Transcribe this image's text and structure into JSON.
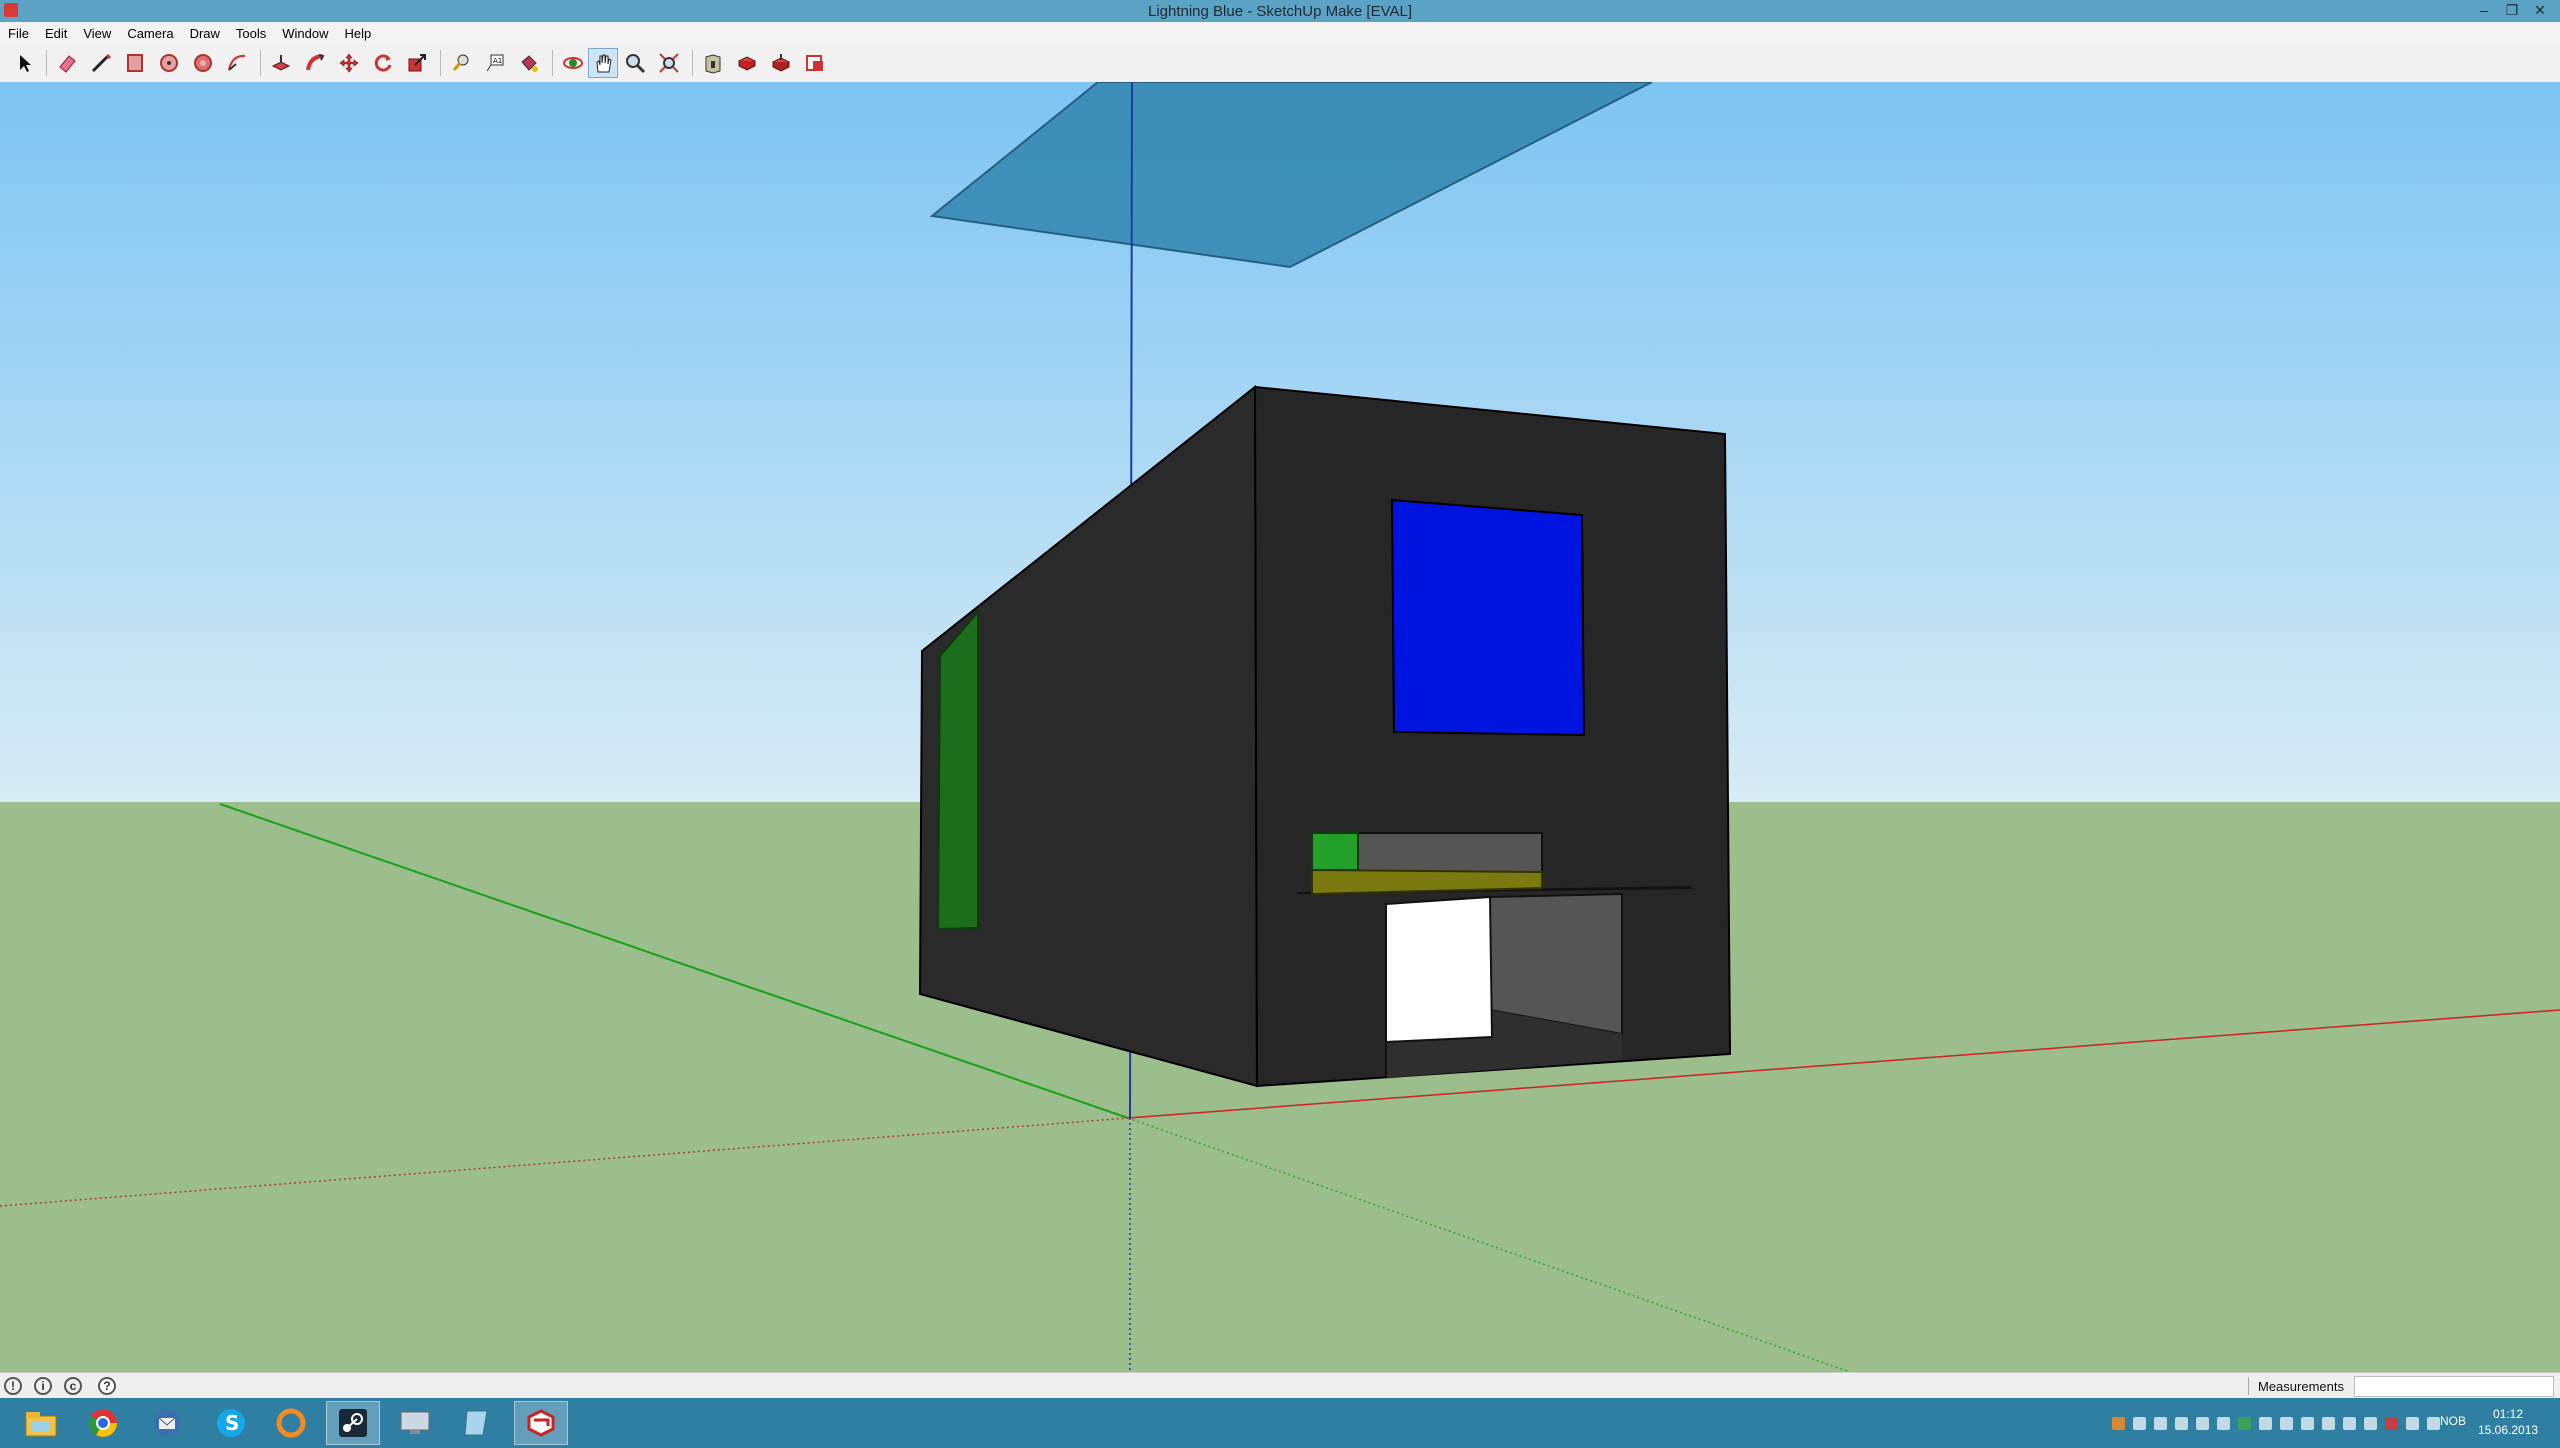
{
  "window": {
    "title": "Lightning Blue - SketchUp Make [EVAL]",
    "controls": [
      "minimize-icon",
      "restore-icon",
      "close-icon"
    ]
  },
  "menu": [
    "File",
    "Edit",
    "View",
    "Camera",
    "Draw",
    "Tools",
    "Window",
    "Help"
  ],
  "toolbar": {
    "tools": [
      "select",
      "eraser",
      "line",
      "rectangle",
      "circle",
      "polygon",
      "arc",
      "push-pull",
      "follow-me",
      "move",
      "rotate",
      "scale",
      "tape-measure",
      "text",
      "paint-bucket",
      "orbit",
      "pan",
      "zoom",
      "zoom-extents",
      "3d-warehouse",
      "get-models",
      "share-model",
      "send-to-layout"
    ],
    "active_tool": "pan"
  },
  "scene": {
    "colors": {
      "sky_top": "#7dc4f3",
      "sky_bottom": "#d8ecf5",
      "ground": "#9cbd8c",
      "walls": "#262626",
      "window_blue": "#0014e0",
      "panel_green": "#1a7a1a",
      "floor_olive": "#7a7a10",
      "door_white": "#ffffff",
      "roof_plane": "#3a8db8"
    }
  },
  "status": {
    "help_icons": [
      "geo-location-icon",
      "credits-icon",
      "copyright-icon",
      "help-icon"
    ],
    "measurements_label": "Measurements",
    "measurements_value": ""
  },
  "taskbar": {
    "apps": [
      "file-explorer",
      "chrome",
      "thunderbird",
      "skype",
      "origin",
      "steam",
      "remote-desktop",
      "notes",
      "sketchup"
    ],
    "active_app": "sketchup",
    "language": "NOB",
    "time": "01:12",
    "date": "15.06.2013"
  }
}
